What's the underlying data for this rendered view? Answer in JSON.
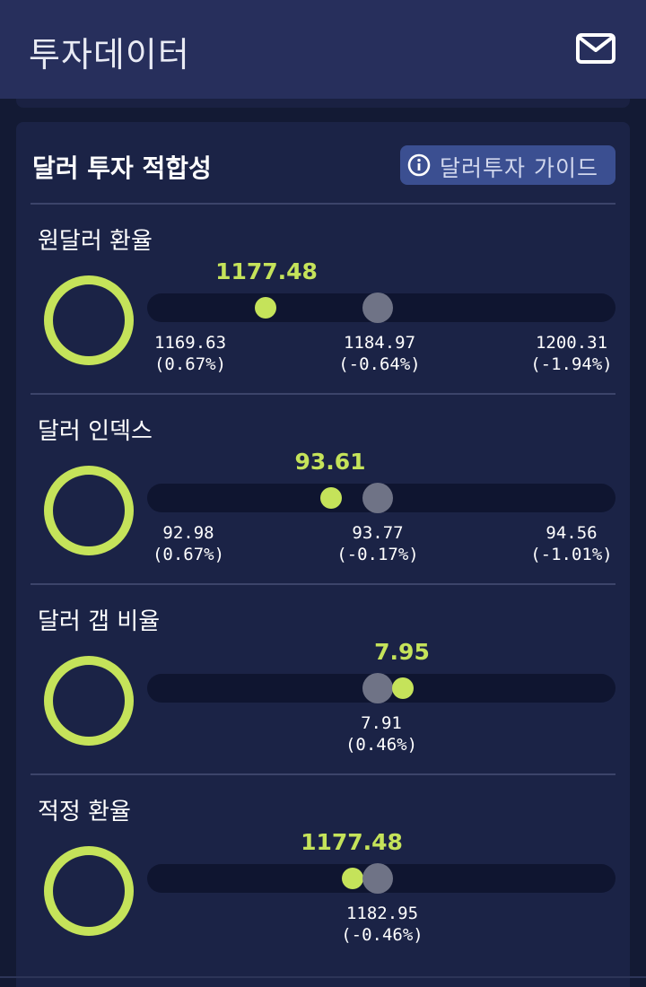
{
  "app": {
    "title": "투자데이터",
    "mail_icon": "mail-icon"
  },
  "card": {
    "title": "달러 투자 적합성",
    "guide_button": {
      "label": "달러투자 가이드",
      "icon": "info-icon"
    }
  },
  "colors": {
    "accent": "#c5e35a",
    "average_dot": "#6f7386",
    "track": "#0f1530",
    "card_bg": "#1b2346",
    "appbar_bg": "#272f5c"
  },
  "sections": [
    {
      "title": "원달러 환율",
      "current": "1177.48",
      "ticks": [
        {
          "value": "1169.63",
          "pct": "(0.67%)"
        },
        {
          "value": "1184.97",
          "pct": "(-0.64%)"
        },
        {
          "value": "1200.31",
          "pct": "(-1.94%)"
        }
      ]
    },
    {
      "title": "달러 인덱스",
      "current": "93.61",
      "ticks": [
        {
          "value": "92.98",
          "pct": "(0.67%)"
        },
        {
          "value": "93.77",
          "pct": "(-0.17%)"
        },
        {
          "value": "94.56",
          "pct": "(-1.01%)"
        }
      ]
    },
    {
      "title": "달러 갭 비율",
      "current": "7.95",
      "ticks": [
        {
          "value": "7.91",
          "pct": "(0.46%)"
        }
      ]
    },
    {
      "title": "적정 환율",
      "current": "1177.48",
      "ticks": [
        {
          "value": "1182.95",
          "pct": "(-0.46%)"
        }
      ]
    }
  ]
}
